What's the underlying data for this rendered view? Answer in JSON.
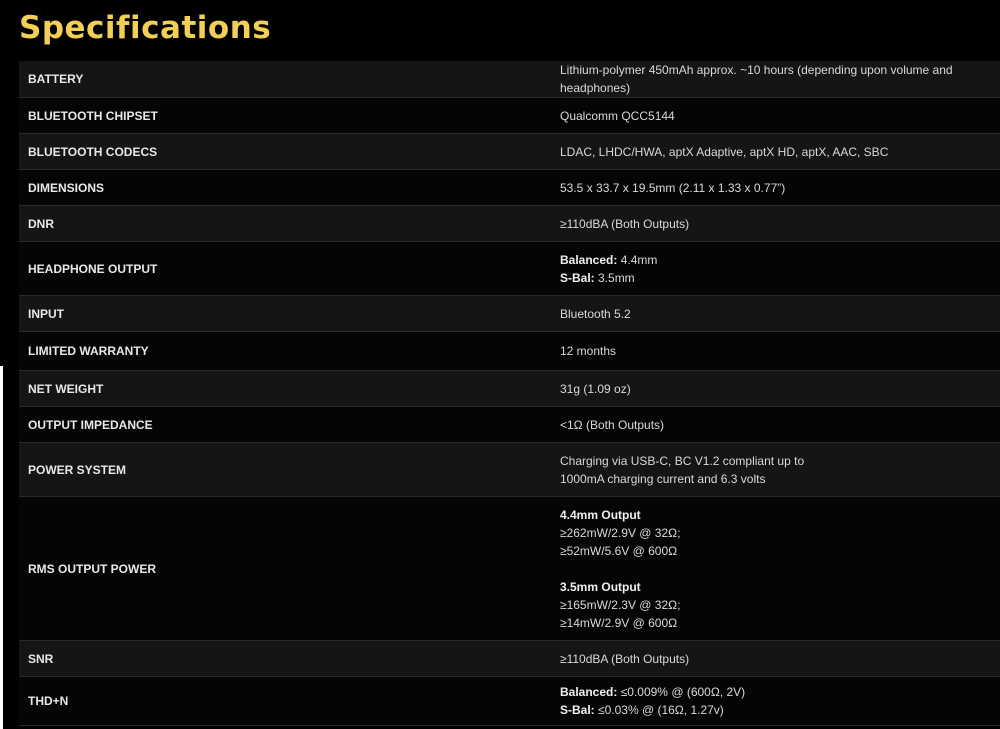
{
  "page": {
    "title": "Specifications",
    "accent_color": "#f2cf55"
  },
  "specs": [
    {
      "label": "BATTERY",
      "value": "Lithium-polymer 450mAh approx. ~10 hours (depending upon volume and headphones)"
    },
    {
      "label": "BLUETOOTH CHIPSET",
      "value": "Qualcomm QCC5144"
    },
    {
      "label": "BLUETOOTH CODECS",
      "value": "LDAC, LHDC/HWA, aptX Adaptive, aptX HD, aptX, AAC, SBC"
    },
    {
      "label": "DIMENSIONS",
      "value": "53.5 x 33.7 x 19.5mm (2.11 x 1.33 x 0.77”)"
    },
    {
      "label": "DNR",
      "value": "≥110dBA (Both Outputs)"
    },
    {
      "label": "HEADPHONE OUTPUT",
      "lines": [
        {
          "bold": "Balanced:",
          "text": " 4.4mm"
        },
        {
          "bold": "S-Bal:",
          "text": " 3.5mm"
        }
      ]
    },
    {
      "label": "INPUT",
      "value": "Bluetooth 5.2"
    },
    {
      "label": "LIMITED WARRANTY",
      "value": "12 months"
    },
    {
      "label": "NET WEIGHT",
      "value": "31g (1.09 oz)"
    },
    {
      "label": "OUTPUT IMPEDANCE",
      "value": "<1Ω (Both Outputs)"
    },
    {
      "label": "POWER SYSTEM",
      "lines": [
        {
          "text": "Charging via USB-C, BC V1.2 compliant up to"
        },
        {
          "text": "1000mA charging current and 6.3 volts"
        }
      ]
    },
    {
      "label": "RMS OUTPUT POWER",
      "lines": [
        {
          "bold": "4.4mm Output"
        },
        {
          "text": "≥262mW/2.9V @ 32Ω;"
        },
        {
          "text": "≥52mW/5.6V @ 600Ω"
        },
        {
          "bold": "3.5mm Output"
        },
        {
          "text": "≥165mW/2.3V @ 32Ω;"
        },
        {
          "text": "≥14mW/2.9V @ 600Ω"
        }
      ]
    },
    {
      "label": "SNR",
      "value": "≥110dBA (Both Outputs)"
    },
    {
      "label": "THD+N",
      "lines": [
        {
          "bold": "Balanced:",
          "text": " ≤0.009% @ (600Ω, 2V)"
        },
        {
          "bold": "S-Bal:",
          "text": " ≤0.03% @ (16Ω, 1.27v)"
        }
      ]
    }
  ]
}
